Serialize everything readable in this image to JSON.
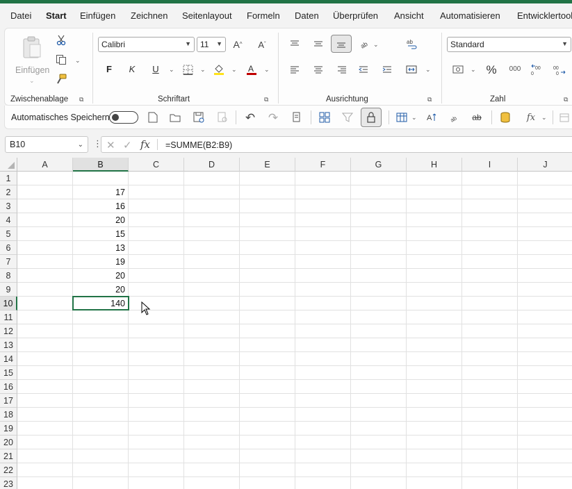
{
  "menu": {
    "tabs": [
      "Datei",
      "Start",
      "Einfügen",
      "Zeichnen",
      "Seitenlayout",
      "Formeln",
      "Daten",
      "Überprüfen",
      "Ansicht",
      "Automatisieren",
      "Entwicklertools"
    ],
    "active": "Start"
  },
  "ribbon": {
    "clipboard": {
      "paste_label": "Einfügen",
      "group_label": "Zwischenablage"
    },
    "font": {
      "font_name": "Calibri",
      "font_size": "11",
      "bold": "F",
      "italic": "K",
      "underline": "U",
      "group_label": "Schriftart"
    },
    "alignment": {
      "group_label": "Ausrichtung"
    },
    "number": {
      "format": "Standard",
      "percent": "%",
      "thousands": "000",
      "group_label": "Zahl"
    }
  },
  "qab": {
    "autosave_label": "Automatisches Speichern",
    "autosave_on": false
  },
  "formula_bar": {
    "name_box": "B10",
    "formula": "=SUMME(B2:B9)"
  },
  "sheet": {
    "columns": [
      "A",
      "B",
      "C",
      "D",
      "E",
      "F",
      "G",
      "H",
      "I",
      "J"
    ],
    "rows": [
      "1",
      "2",
      "3",
      "4",
      "5",
      "6",
      "7",
      "8",
      "9",
      "10",
      "11",
      "12",
      "13",
      "14",
      "15",
      "16",
      "17",
      "18",
      "19",
      "20",
      "21",
      "22",
      "23"
    ],
    "selected_cell": "B10",
    "column_b_values": [
      {
        "row": "2",
        "value": "17"
      },
      {
        "row": "3",
        "value": "16"
      },
      {
        "row": "4",
        "value": "20"
      },
      {
        "row": "5",
        "value": "15"
      },
      {
        "row": "6",
        "value": "13"
      },
      {
        "row": "7",
        "value": "19"
      },
      {
        "row": "8",
        "value": "20"
      },
      {
        "row": "9",
        "value": "20"
      },
      {
        "row": "10",
        "value": "140"
      }
    ]
  },
  "colors": {
    "accent": "#217346"
  }
}
